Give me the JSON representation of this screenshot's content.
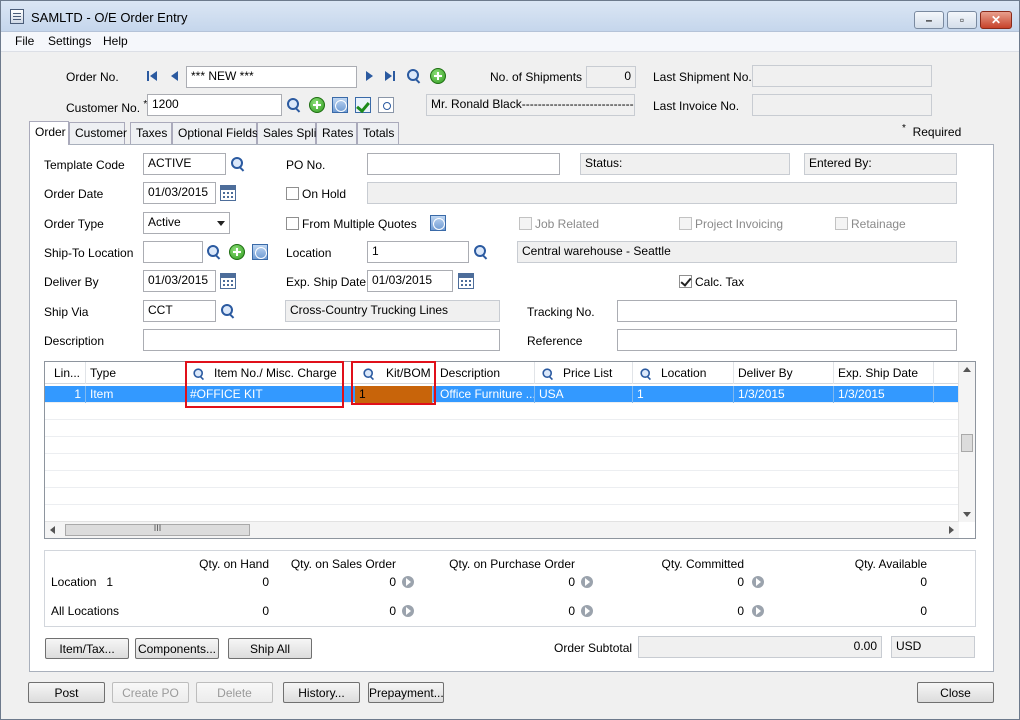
{
  "window": {
    "title": "SAMLTD - O/E Order Entry",
    "controls": {
      "minimize": "–",
      "restore": "▫",
      "close": "✕"
    }
  },
  "menu": {
    "items": [
      "File",
      "Settings",
      "Help"
    ]
  },
  "header": {
    "order_no_label": "Order No.",
    "order_no_value": "*** NEW ***",
    "shipments_label": "No. of Shipments",
    "shipments_value": "0",
    "last_shipment_label": "Last Shipment No.",
    "last_shipment_value": "",
    "customer_no_label": "Customer No.",
    "customer_no_required": "*",
    "customer_no_value": "1200",
    "customer_name": "Mr. Ronald Black------------------------------------",
    "last_invoice_label": "Last Invoice No.",
    "last_invoice_value": "",
    "required_marker": "*",
    "required_label": "Required"
  },
  "tabs": [
    "Order",
    "Customer",
    "Taxes",
    "Optional Fields",
    "Sales Split",
    "Rates",
    "Totals"
  ],
  "order": {
    "template_code_label": "Template Code",
    "template_code_value": "ACTIVE",
    "po_no_label": "PO No.",
    "po_no_value": "",
    "status_label": "Status:",
    "entered_by_label": "Entered By:",
    "order_date_label": "Order Date",
    "order_date_value": "01/03/2015",
    "on_hold_label": "On Hold",
    "on_hold_checked": false,
    "order_type_label": "Order Type",
    "order_type_value": "Active",
    "from_quotes_label": "From Multiple Quotes",
    "from_quotes_checked": false,
    "job_related_label": "Job Related",
    "project_invoicing_label": "Project Invoicing",
    "retainage_label": "Retainage",
    "ship_to_label": "Ship-To Location",
    "ship_to_value": "",
    "location_label": "Location",
    "location_value": "1",
    "location_desc": "Central warehouse - Seattle",
    "deliver_by_label": "Deliver By",
    "deliver_by_value": "01/03/2015",
    "exp_ship_label": "Exp. Ship Date",
    "exp_ship_value": "01/03/2015",
    "calc_tax_label": "Calc. Tax",
    "calc_tax_checked": true,
    "ship_via_label": "Ship Via",
    "ship_via_value": "CCT",
    "ship_via_desc": "Cross-Country Trucking Lines",
    "tracking_label": "Tracking No.",
    "tracking_value": "",
    "description_label": "Description",
    "description_value": "",
    "reference_label": "Reference",
    "reference_value": ""
  },
  "grid": {
    "columns": [
      "Lin...",
      "Type",
      "Item No./ Misc. Charge",
      "Kit/BOM",
      "Description",
      "Price List",
      "Location",
      "Deliver By",
      "Exp. Ship Date"
    ],
    "rows": [
      [
        "1",
        "Item",
        "#OFFICE KIT",
        "1",
        "Office Furniture ...",
        "USA",
        "1",
        "1/3/2015",
        "1/3/2015"
      ]
    ],
    "scroll_glyph": "III"
  },
  "summary": {
    "headers": [
      "Qty. on Hand",
      "Qty. on Sales Order",
      "Qty. on Purchase Order",
      "Qty. Committed",
      "Qty. Available"
    ],
    "location_label": "Location",
    "location_value": "1",
    "location_values": [
      "0",
      "0",
      "0",
      "0",
      "0"
    ],
    "all_locations_label": "All Locations",
    "all_values": [
      "0",
      "0",
      "0",
      "0",
      "0"
    ]
  },
  "actions": {
    "item_tax": "Item/Tax...",
    "components": "Components...",
    "ship_all": "Ship All",
    "order_subtotal_label": "Order Subtotal",
    "order_subtotal_value": "0.00",
    "currency": "USD"
  },
  "footer": {
    "post": "Post",
    "create_po": "Create PO",
    "delete": "Delete",
    "history": "History...",
    "prepayment": "Prepayment...",
    "close": "Close"
  },
  "colors": {
    "selection": "#3399ff",
    "highlight_box": "#e0101a",
    "kit_cell": "#c8640a"
  }
}
